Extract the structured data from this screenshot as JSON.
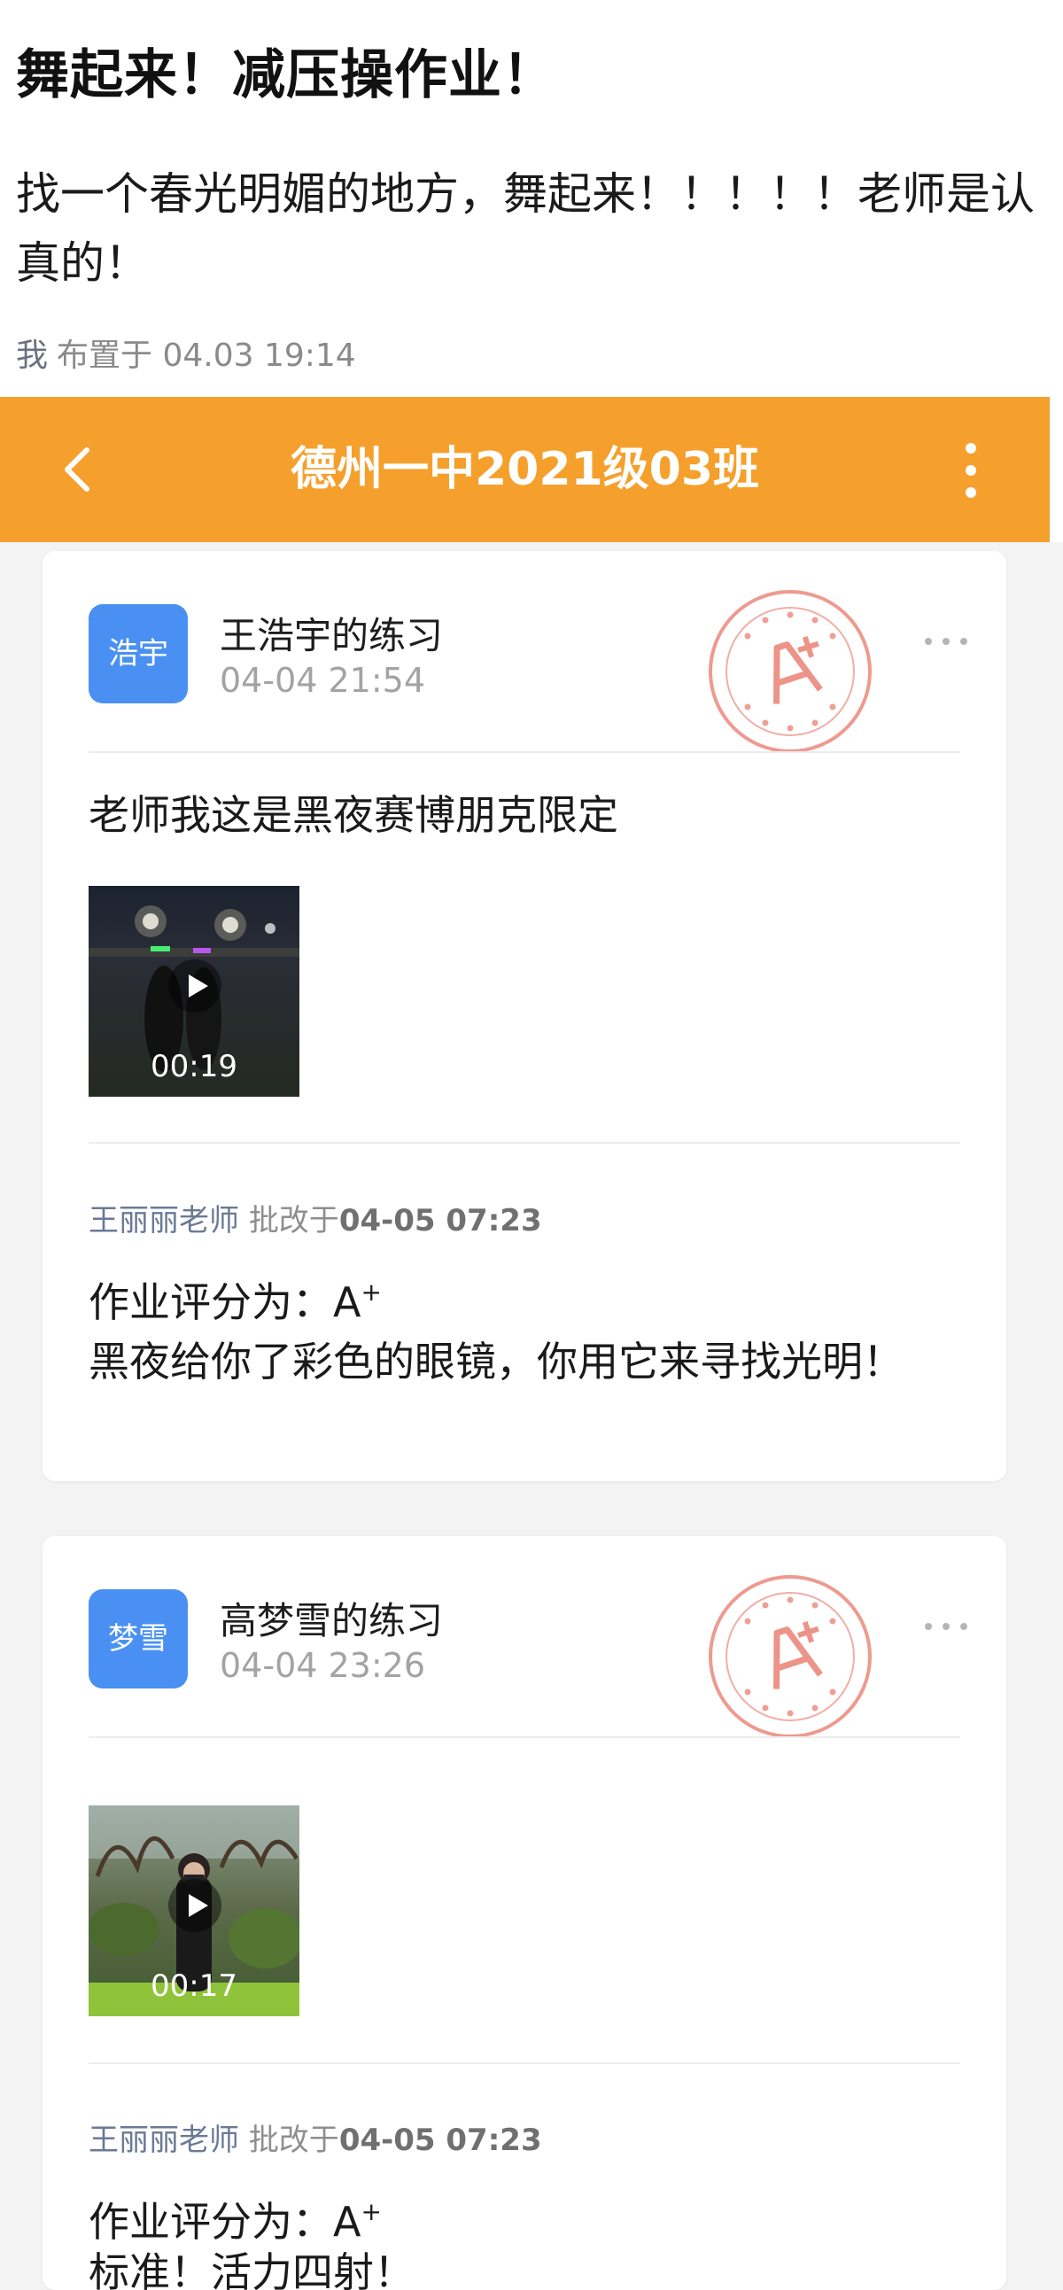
{
  "assignment": {
    "title": "舞起来！减压操作业！",
    "description": "找一个春光明媚的地方，舞起来！！！！！老师是认真的！",
    "author": "我",
    "posted_text": "布置于 04.03 19:14"
  },
  "navbar": {
    "title": "德州一中2021级03班",
    "back_icon": "chevron-left-icon",
    "more_icon": "vertical-dots-icon",
    "bg_color": "#f5a02d"
  },
  "submissions": [
    {
      "avatar_text": "浩宇",
      "name": "王浩宇的练习",
      "time": "04-04 21:54",
      "comment": "老师我这是黑夜赛博朋克限定",
      "video_duration": "00:19",
      "reviewer": "王丽丽老师",
      "reviewed_label": "批改于",
      "review_time": "04-05 07:23",
      "score_label": "作业评分为：",
      "score": "A",
      "score_sup": "+",
      "feedback": "黑夜给你了彩色的眼镜，你用它来寻找光明！"
    },
    {
      "avatar_text": "梦雪",
      "name": "高梦雪的练习",
      "time": "04-04 23:26",
      "comment": "",
      "video_duration": "00:17",
      "reviewer": "王丽丽老师",
      "reviewed_label": "批改于",
      "review_time": "04-05 07:23",
      "score_label": "作业评分为：",
      "score": "A",
      "score_sup": "+",
      "feedback": "标准！活力四射！"
    }
  ],
  "colors": {
    "accent": "#f5a02d",
    "avatar": "#4a90f2",
    "stamp": "#e8786a"
  }
}
